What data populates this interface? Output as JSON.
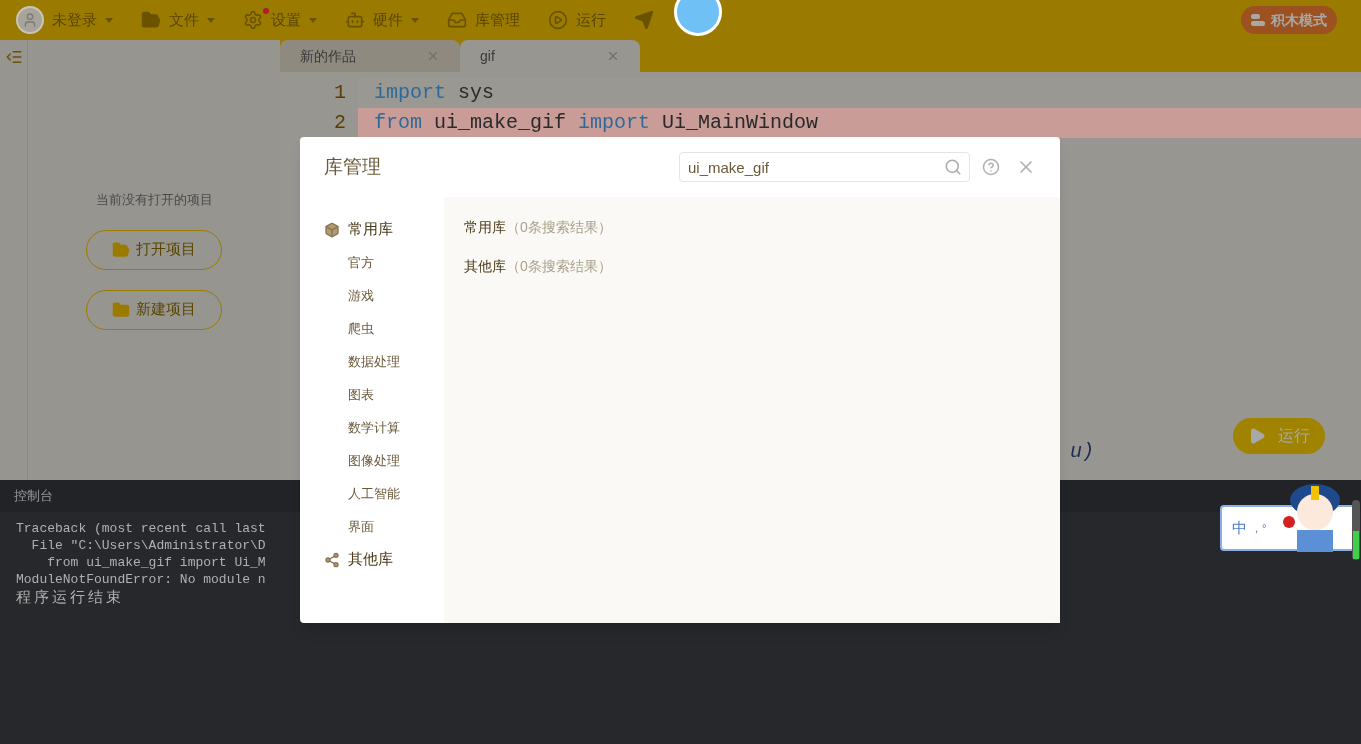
{
  "toolbar": {
    "items": [
      {
        "label": "未登录",
        "kind": "avatar",
        "caret": true,
        "badge": false
      },
      {
        "label": "文件",
        "kind": "folder",
        "caret": true,
        "badge": false
      },
      {
        "label": "设置",
        "kind": "gear",
        "caret": true,
        "badge": true
      },
      {
        "label": "硬件",
        "kind": "robot",
        "caret": true,
        "badge": false
      },
      {
        "label": "库管理",
        "kind": "tray",
        "caret": false,
        "badge": false
      },
      {
        "label": "运行",
        "kind": "play",
        "caret": false,
        "badge": false
      },
      {
        "kind": "plane",
        "caret": false,
        "badge": false
      }
    ],
    "mode_button": "积木模式"
  },
  "sidebar": {
    "message": "当前没有打开的项目",
    "buttons": [
      {
        "label": "打开项目",
        "kind": "open"
      },
      {
        "label": "新建项目",
        "kind": "new"
      }
    ]
  },
  "tabs": [
    {
      "label": "新的作品",
      "selected": false
    },
    {
      "label": "gif",
      "selected": true
    }
  ],
  "editor": {
    "lines": [
      {
        "number": "1",
        "tokens": [
          {
            "text": "import",
            "kind": "keyword"
          },
          {
            "text": " sys",
            "kind": "plain"
          }
        ],
        "error": false
      },
      {
        "number": "2",
        "tokens": [
          {
            "text": "from",
            "kind": "keyword"
          },
          {
            "text": " ui_make_gif ",
            "kind": "plain"
          },
          {
            "text": "import",
            "kind": "keyword"
          },
          {
            "text": " Ui_MainWindow",
            "kind": "plain"
          }
        ],
        "error": true
      }
    ],
    "fragment": "u)",
    "run_button": "运行"
  },
  "console": {
    "title": "控制台",
    "lines": [
      "Traceback (most recent call last",
      "  File \"C:\\Users\\Administrator\\D",
      "    from ui_make_gif import Ui_M",
      "ModuleNotFoundError: No module n"
    ],
    "status": "程序运行结束"
  },
  "ime": {
    "label": "中",
    "marks": "，°"
  },
  "dialog": {
    "title": "库管理",
    "search": {
      "value": "ui_make_gif"
    },
    "nav": [
      {
        "label": "常用库",
        "kind": "common",
        "children": [
          "官方",
          "游戏",
          "爬虫",
          "数据处理",
          "图表",
          "数学计算",
          "图像处理",
          "人工智能",
          "界面"
        ]
      },
      {
        "label": "其他库",
        "kind": "other"
      }
    ],
    "results": [
      {
        "name": "常用库",
        "count": "（0条搜索结果）"
      },
      {
        "name": "其他库",
        "count": "（0条搜索结果）"
      }
    ]
  }
}
